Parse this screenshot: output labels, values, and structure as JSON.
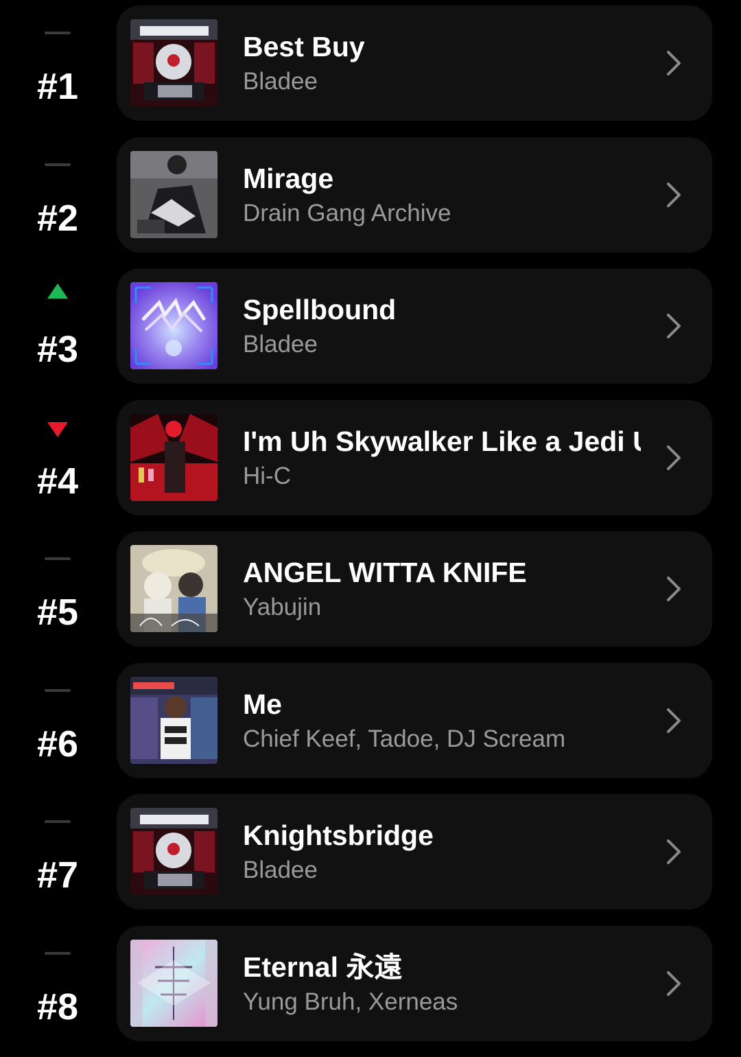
{
  "chart": {
    "items": [
      {
        "rank": "#1",
        "trend": "same",
        "title": "Best Buy",
        "artist": "Bladee",
        "art": "wod-art"
      },
      {
        "rank": "#2",
        "trend": "same",
        "title": "Mirage",
        "artist": "Drain Gang Archive",
        "art": "mirage-art"
      },
      {
        "rank": "#3",
        "trend": "up",
        "title": "Spellbound",
        "artist": "Bladee",
        "art": "spellbound-art"
      },
      {
        "rank": "#4",
        "trend": "down",
        "title": "I'm Uh Skywalker Like a Jedi U",
        "artist": "Hi-C",
        "art": "skywalker-art"
      },
      {
        "rank": "#5",
        "trend": "same",
        "title": "ANGEL WITTA KNIFE",
        "artist": "Yabujin",
        "art": "flesh-desire-art"
      },
      {
        "rank": "#6",
        "trend": "same",
        "title": "Me",
        "artist": "Chief Keef, Tadoe, DJ Scream",
        "art": "chief-keef-art"
      },
      {
        "rank": "#7",
        "trend": "same",
        "title": "Knightsbridge",
        "artist": "Bladee",
        "art": "wod-art"
      },
      {
        "rank": "#8",
        "trend": "same",
        "title": "Eternal 永遠",
        "artist": "Yung Bruh, Xerneas",
        "art": "eternal-art"
      }
    ]
  },
  "colors": {
    "trend_up": "#1db954",
    "trend_down": "#e8192c",
    "card": "#111111",
    "subtitle": "#9a9a9a"
  }
}
